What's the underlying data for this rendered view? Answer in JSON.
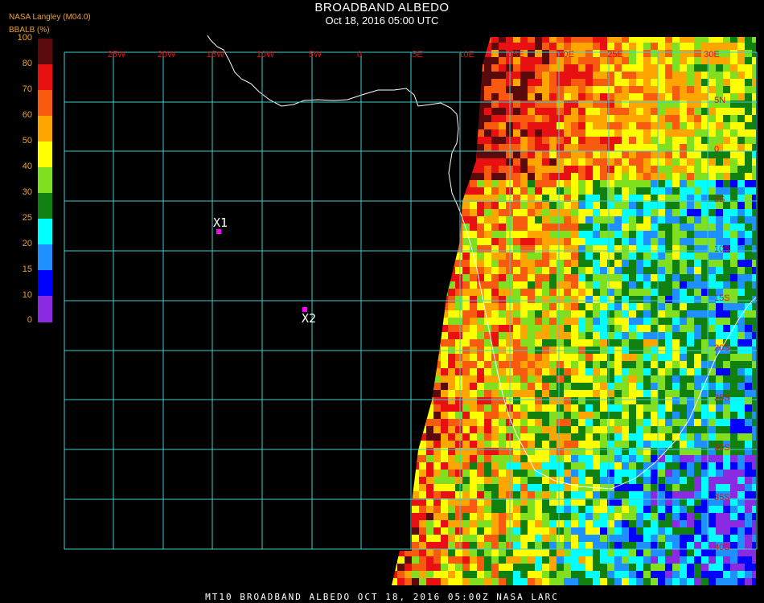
{
  "header": {
    "title": "BROADBAND ALBEDO",
    "subtitle": "Oct 18, 2016 05:00 UTC",
    "source": "NASA Langley (M04.0)"
  },
  "legend": {
    "title": "BBALB (%)",
    "ticks": [
      "100",
      "80",
      "70",
      "60",
      "50",
      "40",
      "30",
      "25",
      "20",
      "15",
      "10",
      "0"
    ],
    "bins": [
      {
        "range": "80-100",
        "color": "#5a0a0a"
      },
      {
        "range": "70-80",
        "color": "#e81010"
      },
      {
        "range": "60-70",
        "color": "#f85a10"
      },
      {
        "range": "50-60",
        "color": "#ffa500"
      },
      {
        "range": "40-50",
        "color": "#ffff00"
      },
      {
        "range": "30-40",
        "color": "#80e020"
      },
      {
        "range": "25-30",
        "color": "#108010"
      },
      {
        "range": "20-25",
        "color": "#00ffff"
      },
      {
        "range": "15-20",
        "color": "#1e90ff"
      },
      {
        "range": "10-15",
        "color": "#0000ff"
      },
      {
        "range": "0-10",
        "color": "#8a2be2"
      }
    ]
  },
  "map": {
    "grid_color": "#40d0d0",
    "label_color": "#e01010",
    "longitude_labels": [
      "25W",
      "20W",
      "15W",
      "10W",
      "5W",
      "0",
      "5E",
      "10E",
      "15E",
      "20E",
      "25E",
      "30E"
    ],
    "latitude_labels": [
      "5N",
      "0",
      "5S",
      "10S",
      "15S",
      "20S",
      "25S",
      "30S",
      "35S",
      "40S"
    ],
    "markers": [
      {
        "label": "X1",
        "color": "#ff00ff"
      },
      {
        "label": "X2",
        "color": "#ff00ff"
      }
    ]
  },
  "footer": {
    "text": "MT10  BROADBAND ALBEDO   OCT 18, 2016 05:00Z   NASA LARC"
  }
}
